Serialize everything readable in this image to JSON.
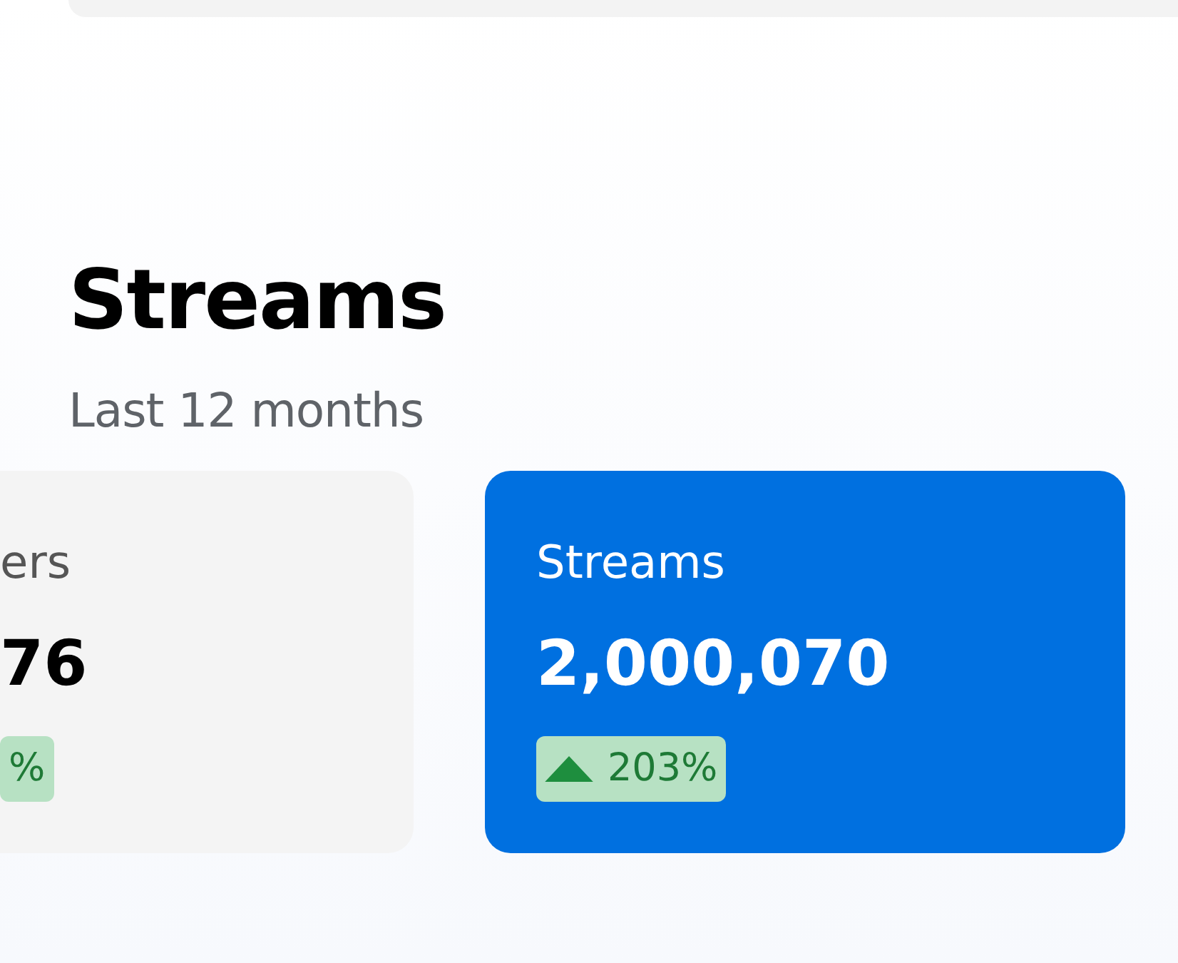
{
  "section": {
    "title": "Streams",
    "subtitle": "Last 12 months"
  },
  "cards": [
    {
      "label": "ers",
      "value": "76",
      "change": {
        "text": "%"
      },
      "selected": false
    },
    {
      "label": "Streams",
      "value": "2,000,070",
      "change": {
        "text": "203%",
        "rising": true
      },
      "selected": true
    }
  ]
}
